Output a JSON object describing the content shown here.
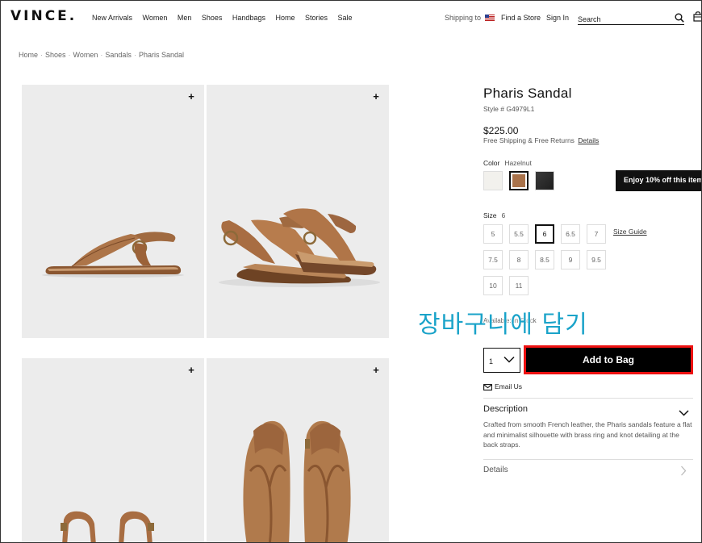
{
  "header": {
    "logo": "VINCE.",
    "nav": [
      "New Arrivals",
      "Women",
      "Men",
      "Shoes",
      "Handbags",
      "Home",
      "Stories",
      "Sale"
    ],
    "shipping_to": "Shipping to",
    "find_store": "Find a Store",
    "sign_in": "Sign In",
    "search_placeholder": "Search"
  },
  "breadcrumb": [
    "Home",
    "Shoes",
    "Women",
    "Sandals",
    "Pharis Sandal"
  ],
  "product": {
    "name": "Pharis Sandal",
    "style": "Style # G4979L1",
    "price": "$225.00",
    "shipping": "Free Shipping & Free Returns",
    "details_link": "Details",
    "color_label": "Color",
    "color_value": "Hazelnut",
    "swatches": [
      {
        "name": "white",
        "hex": "#f2f1ed"
      },
      {
        "name": "Hazelnut",
        "hex": "#a9724a",
        "selected": true
      },
      {
        "name": "black",
        "hex": "#2b2b2b"
      }
    ],
    "size_label": "Size",
    "size_value": "6",
    "sizes": [
      "5",
      "5.5",
      "6",
      "6.5",
      "7",
      "7.5",
      "8",
      "8.5",
      "9",
      "9.5",
      "10",
      "11"
    ],
    "selected_size": "6",
    "size_guide": "Size Guide",
    "availability": "Available: In Stock",
    "quantity": "1",
    "add_to_bag": "Add to Bag",
    "email_us": "Email Us",
    "description_title": "Description",
    "description_text": "Crafted from smooth French leather, the Pharis sandals feature a flat and minimalist silhouette with brass ring and knot detailing at the back straps.",
    "details_title": "Details"
  },
  "promo": "Enjoy 10% off this item",
  "annotation": "장바구니에 담기",
  "colors": {
    "highlight": "#ee1111",
    "annotation": "#1aa3c9",
    "leather": "#a9724a"
  }
}
